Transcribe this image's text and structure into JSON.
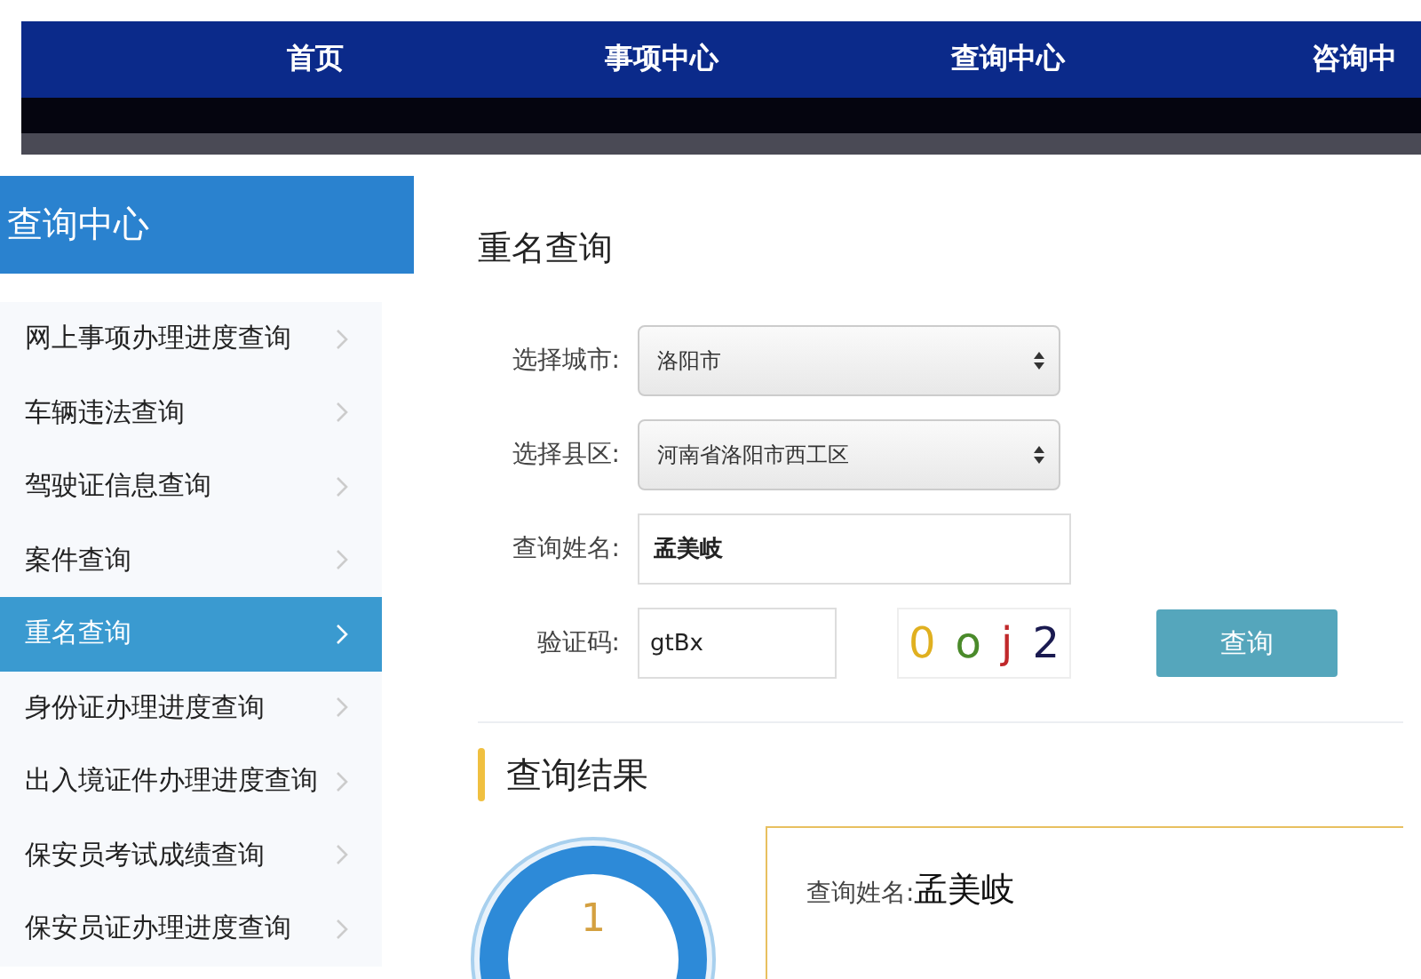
{
  "nav": {
    "items": [
      "首页",
      "事项中心",
      "查询中心",
      "咨询中"
    ]
  },
  "sidebar": {
    "title": "查询中心",
    "items": [
      {
        "label": "网上事项办理进度查询",
        "selected": false
      },
      {
        "label": "车辆违法查询",
        "selected": false
      },
      {
        "label": "驾驶证信息查询",
        "selected": false
      },
      {
        "label": "案件查询",
        "selected": false
      },
      {
        "label": "重名查询",
        "selected": true
      },
      {
        "label": "身份证办理进度查询",
        "selected": false
      },
      {
        "label": "出入境证件办理进度查询",
        "selected": false
      },
      {
        "label": "保安员考试成绩查询",
        "selected": false
      },
      {
        "label": "保安员证办理进度查询",
        "selected": false
      }
    ]
  },
  "form": {
    "title": "重名查询",
    "fields": [
      {
        "kind": "select",
        "label": "选择城市:",
        "value": "洛阳市"
      },
      {
        "kind": "select",
        "label": "选择县区:",
        "value": "河南省洛阳市西工区"
      },
      {
        "kind": "input",
        "label": "查询姓名:",
        "value": "孟美岐"
      },
      {
        "kind": "captcha",
        "label": "验证码:",
        "value": "gtBx",
        "captcha": [
          {
            "char": "0",
            "color": "#e0b020"
          },
          {
            "char": "o",
            "color": "#4a8a2a"
          },
          {
            "char": "j",
            "color": "#c0282a"
          },
          {
            "char": "2",
            "color": "#1a1a50"
          }
        ]
      }
    ],
    "button": "查询"
  },
  "result": {
    "title": "查询结果",
    "count": "1",
    "label": "查询姓名:",
    "name": "孟美岐"
  }
}
